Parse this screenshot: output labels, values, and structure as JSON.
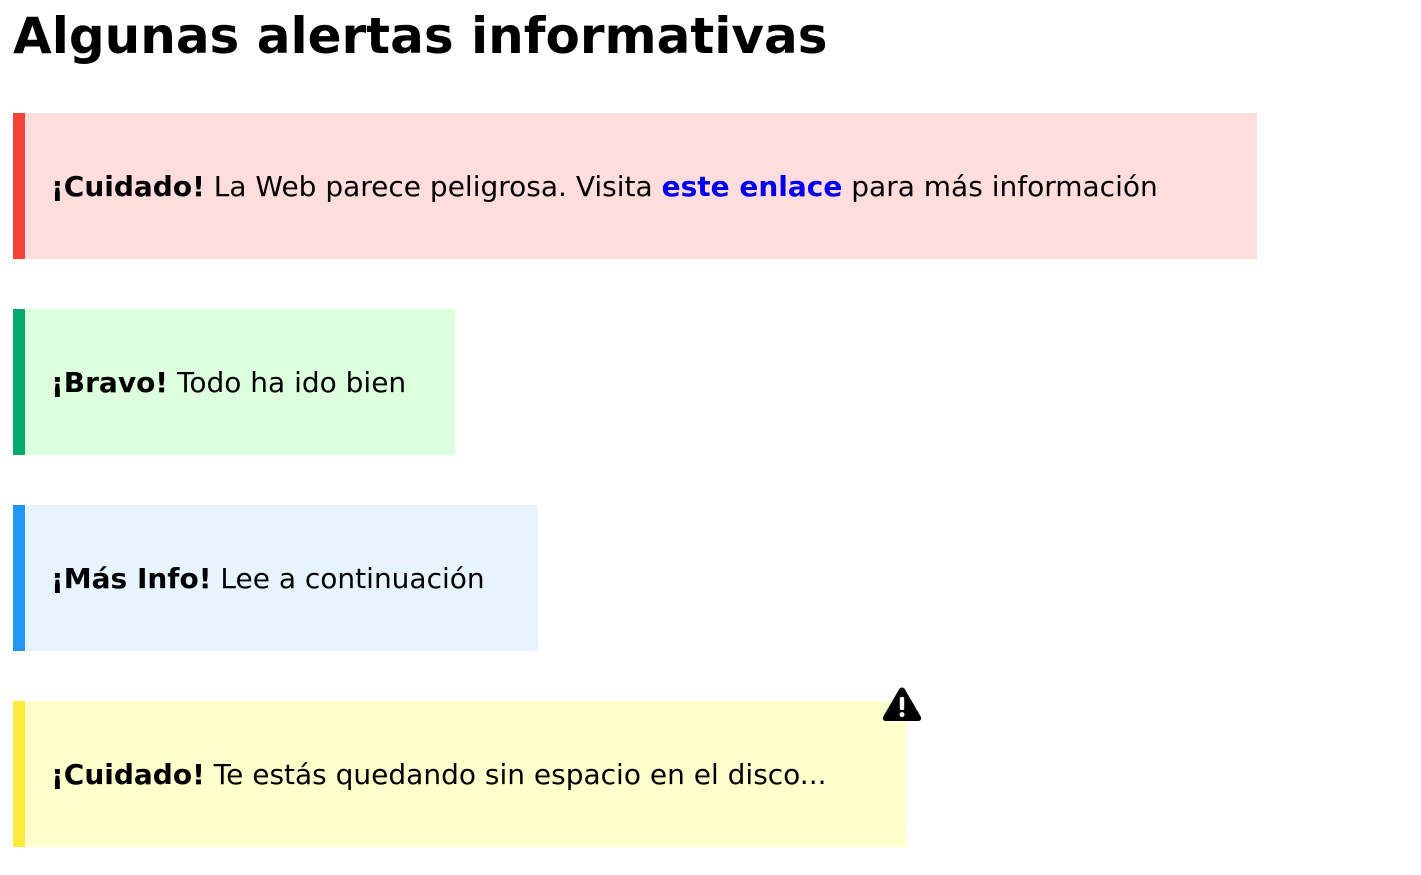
{
  "page": {
    "title": "Algunas alertas informativas"
  },
  "alerts": [
    {
      "type": "danger",
      "strong": "¡Cuidado!",
      "text_before": "La Web parece peligrosa. Visita",
      "link_text": "este enlace",
      "text_after": "para más información",
      "border_color": "#f44336",
      "background_color": "#ffdddd"
    },
    {
      "type": "success",
      "strong": "¡Bravo!",
      "text": "Todo ha ido bien",
      "border_color": "#04aa6d",
      "background_color": "#ddffdd"
    },
    {
      "type": "info",
      "strong": "¡Más Info!",
      "text": "Lee a continuación",
      "border_color": "#2196f3",
      "background_color": "#e7f3fe"
    },
    {
      "type": "warning",
      "strong": "¡Cuidado!",
      "text": "Te estás quedando sin espacio en el disco...",
      "border_color": "#ffeb3b",
      "background_color": "#ffffcc",
      "icon": "warning-triangle-icon"
    }
  ]
}
